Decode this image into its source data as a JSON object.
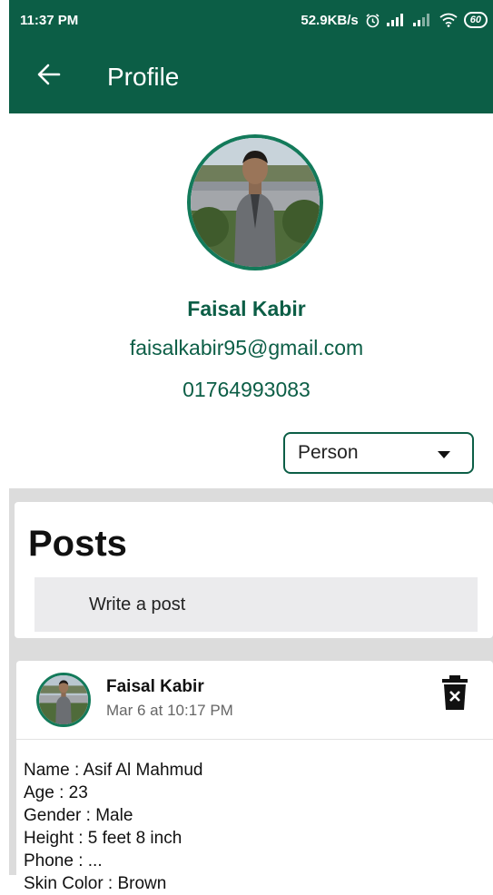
{
  "status_bar": {
    "time": "11:37 PM",
    "network_speed": "52.9KB/s",
    "battery": "60"
  },
  "app_bar": {
    "title": "Profile"
  },
  "profile": {
    "name": "Faisal Kabir",
    "email": "faisalkabir95@gmail.com",
    "phone": "01764993083"
  },
  "dropdown": {
    "selected": "Person"
  },
  "posts_section": {
    "title": "Posts",
    "write_placeholder": "Write a post"
  },
  "post": {
    "author": "Faisal Kabir",
    "timestamp": "Mar 6 at 10:17 PM",
    "lines": [
      "Name : Asif Al Mahmud",
      "Age : 23",
      "Gender : Male",
      "Height : 5 feet 8 inch",
      "Phone : ...",
      "Skin Color : Brown"
    ]
  },
  "colors": {
    "primary": "#0c5e46",
    "avatar_ring": "#137a5a",
    "feed_background": "#dcdcdc",
    "input_background": "#ebebed"
  },
  "icons": {
    "back": "arrow-left-icon",
    "alarm": "alarm-icon",
    "signal": "signal-icon",
    "wifi": "wifi-icon",
    "battery": "battery-icon",
    "dropdown": "caret-down-icon",
    "delete": "trash-icon"
  }
}
